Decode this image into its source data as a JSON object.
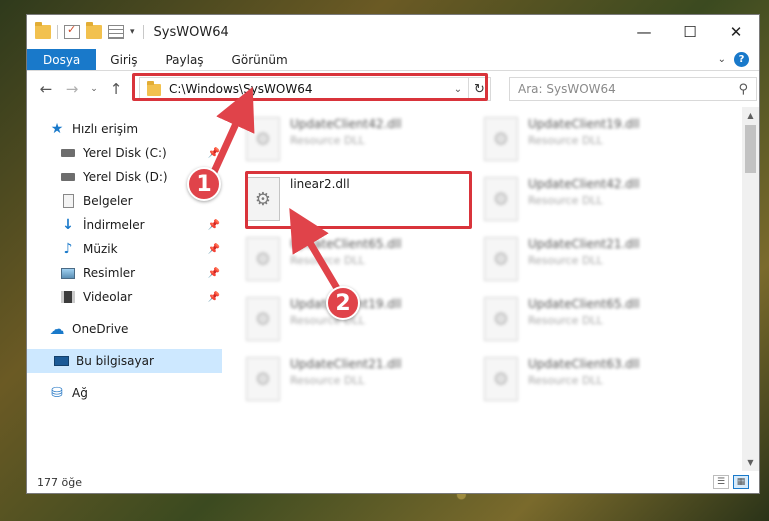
{
  "window": {
    "title": "SysWOW64",
    "controls": {
      "minimize": "—",
      "maximize": "☐",
      "close": "✕"
    }
  },
  "quick_access_toolbar": {
    "icons": [
      "folder-icon",
      "properties-icon",
      "new-folder-icon",
      "customize-icon"
    ],
    "dropdown": "▾"
  },
  "ribbon": {
    "tabs": [
      "Dosya",
      "Giriş",
      "Paylaş",
      "Görünüm"
    ],
    "expand": "⌄",
    "help": "?"
  },
  "navigation": {
    "back": "←",
    "forward": "→",
    "recent": "⌄",
    "up": "↑",
    "address": "C:\\Windows\\SysWOW64",
    "address_dropdown": "⌄",
    "refresh": "↻",
    "search_placeholder": "Ara: SysWOW64",
    "search_icon": "⚲"
  },
  "sidebar": {
    "quick_access": "Hızlı erişim",
    "items": [
      {
        "label": "Yerel Disk (C:)",
        "icon": "drive-icon",
        "pinned": true
      },
      {
        "label": "Yerel Disk (D:)",
        "icon": "drive-icon",
        "pinned": false
      },
      {
        "label": "Belgeler",
        "icon": "documents-icon",
        "pinned": false
      },
      {
        "label": "İndirmeler",
        "icon": "downloads-icon",
        "pinned": true
      },
      {
        "label": "Müzik",
        "icon": "music-icon",
        "pinned": true
      },
      {
        "label": "Resimler",
        "icon": "pictures-icon",
        "pinned": true
      },
      {
        "label": "Videolar",
        "icon": "videos-icon",
        "pinned": true
      }
    ],
    "onedrive": "OneDrive",
    "this_pc": "Bu bilgisayar",
    "network": "Ağ",
    "pin_glyph": "📌"
  },
  "files": {
    "highlighted": {
      "name": "linear2.dll",
      "type": ""
    },
    "left_column": [
      {
        "name": "UpdateClient42.dll",
        "type": "Resource DLL"
      },
      {
        "name": "UpdateClient65.dll",
        "type": "Resource DLL"
      },
      {
        "name": "UpdateClient19.dll",
        "type": "Resource DLL"
      },
      {
        "name": "UpdateClient21.dll",
        "type": "Resource DLL"
      }
    ],
    "right_column": [
      {
        "name": "UpdateClient19.dll",
        "type": "Resource DLL"
      },
      {
        "name": "UpdateClient42.dll",
        "type": "Resource DLL"
      },
      {
        "name": "UpdateClient21.dll",
        "type": "Resource DLL"
      },
      {
        "name": "UpdateClient65.dll",
        "type": "Resource DLL"
      },
      {
        "name": "UpdateClient63.dll",
        "type": "Resource DLL"
      }
    ],
    "gear_glyph": "⚙"
  },
  "status": {
    "count": "177 öğe",
    "view_details": "☰",
    "view_tiles": "▦"
  },
  "callouts": {
    "step1": "1",
    "step2": "2",
    "color": "#e0434a"
  }
}
